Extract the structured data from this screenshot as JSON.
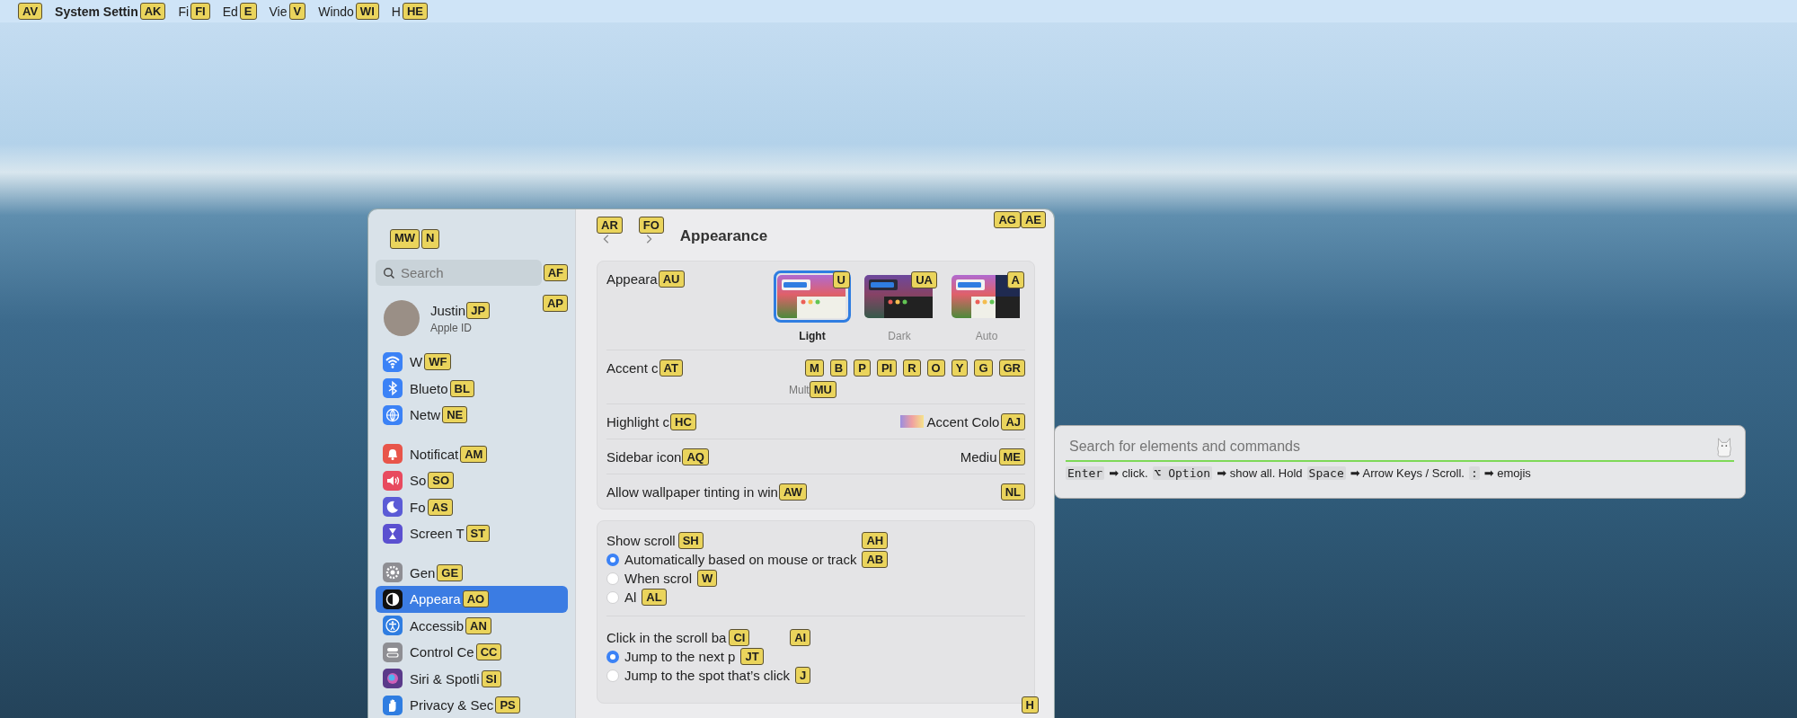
{
  "menu_bar": {
    "apple_hint": "AV",
    "items": [
      {
        "kind": "app",
        "label": "System Settin",
        "hint": "AK"
      },
      {
        "kind": "menu",
        "label": "Fi",
        "hint": "FI"
      },
      {
        "kind": "menu",
        "label": "Ed",
        "hint": "E"
      },
      {
        "kind": "menu",
        "label": "Vie",
        "hint": "V"
      },
      {
        "kind": "menu",
        "label": "Windo",
        "hint": "WI"
      },
      {
        "kind": "menu",
        "label": "H",
        "hint": "HE"
      }
    ]
  },
  "window": {
    "traffic_hints": [
      "MW",
      "N"
    ],
    "toolbar": {
      "back_hint": "AR",
      "forward_hint": "FO",
      "title": "Appearance",
      "corner_hints": [
        "AG",
        "AE"
      ]
    },
    "sidebar": {
      "search": {
        "placeholder": "Search",
        "hint": "AF"
      },
      "profile": {
        "name": "Justin",
        "hint": "JP",
        "subtitle": "Apple ID",
        "side_hint": "AP"
      },
      "groups": [
        [
          {
            "label": "W",
            "hint": "WF",
            "selected": false
          },
          {
            "label": "Blueto",
            "hint": "BL",
            "selected": false
          },
          {
            "label": "Netw",
            "hint": "NE",
            "selected": false
          }
        ],
        [
          {
            "label": "Notificat",
            "hint": "AM",
            "selected": false
          },
          {
            "label": "So",
            "hint": "SO",
            "selected": false
          },
          {
            "label": "Fo",
            "hint": "AS",
            "selected": false
          },
          {
            "label": "Screen T",
            "hint": "ST",
            "selected": false
          }
        ],
        [
          {
            "label": "Gen",
            "hint": "GE",
            "selected": false
          },
          {
            "label": "Appeara",
            "hint": "AO",
            "selected": true
          },
          {
            "label": "Accessib",
            "hint": "AN",
            "selected": false
          },
          {
            "label": "Control Ce",
            "hint": "CC",
            "selected": false
          },
          {
            "label": "Siri & Spotli",
            "hint": "SI",
            "selected": false
          },
          {
            "label": "Privacy & Sec",
            "hint": "PS",
            "selected": false
          }
        ]
      ]
    },
    "content": {
      "appearance_group": [
        {
          "kind": "appearance",
          "label": "Appeara",
          "hint": "AU",
          "options": [
            {
              "label": "Light",
              "hint": "U",
              "selected": true
            },
            {
              "label": "Dark",
              "hint": "UA",
              "selected": false
            },
            {
              "label": "Auto",
              "hint": "A",
              "selected": false
            }
          ]
        },
        {
          "kind": "accent",
          "label": "Accent c",
          "hint": "AT",
          "swatch_hints": [
            "M",
            "B",
            "P",
            "PI",
            "R",
            "O",
            "Y",
            "G",
            "GR"
          ],
          "caption": "Mult",
          "caption_hint": "MU"
        },
        {
          "kind": "swatch_value",
          "label": "Highlight c",
          "hint": "HC",
          "value": "Accent Colo",
          "value_hint": "AJ"
        },
        {
          "kind": "value",
          "label": "Sidebar icon",
          "hint": "AQ",
          "value": "Mediu",
          "value_hint": "ME"
        },
        {
          "kind": "toggle",
          "label": "Allow wallpaper tinting in win",
          "hint": "AW",
          "control_hint": "NL"
        }
      ],
      "scroll_group": [
        {
          "label": "Show scroll",
          "hint": "SH",
          "extra_hint": "AH",
          "options": [
            {
              "label": "Automatically based on mouse or track",
              "hint": "AB",
              "selected": true
            },
            {
              "label": "When scrol",
              "hint": "W",
              "selected": false
            },
            {
              "label": "Al",
              "hint": "AL",
              "selected": false
            }
          ]
        },
        {
          "label": "Click in the scroll ba",
          "hint": "CI",
          "extra_hint": "AI",
          "options": [
            {
              "label": "Jump to the next p",
              "hint": "JT",
              "selected": true
            },
            {
              "label": "Jump to the spot that’s click",
              "hint": "J",
              "selected": false
            }
          ]
        }
      ],
      "footer_hint": "H"
    }
  },
  "command_bar": {
    "placeholder": "Search for elements and commands",
    "help": [
      {
        "kind": "key",
        "text": "Enter"
      },
      {
        "kind": "text",
        "text": "➡ click."
      },
      {
        "kind": "key",
        "text": "⌥ Option"
      },
      {
        "kind": "text",
        "text": "➡ show all. Hold"
      },
      {
        "kind": "key",
        "text": "Space"
      },
      {
        "kind": "text",
        "text": "➡ Arrow Keys / Scroll."
      },
      {
        "kind": "key",
        "text": ":"
      },
      {
        "kind": "text",
        "text": "➡ emojis"
      }
    ]
  }
}
